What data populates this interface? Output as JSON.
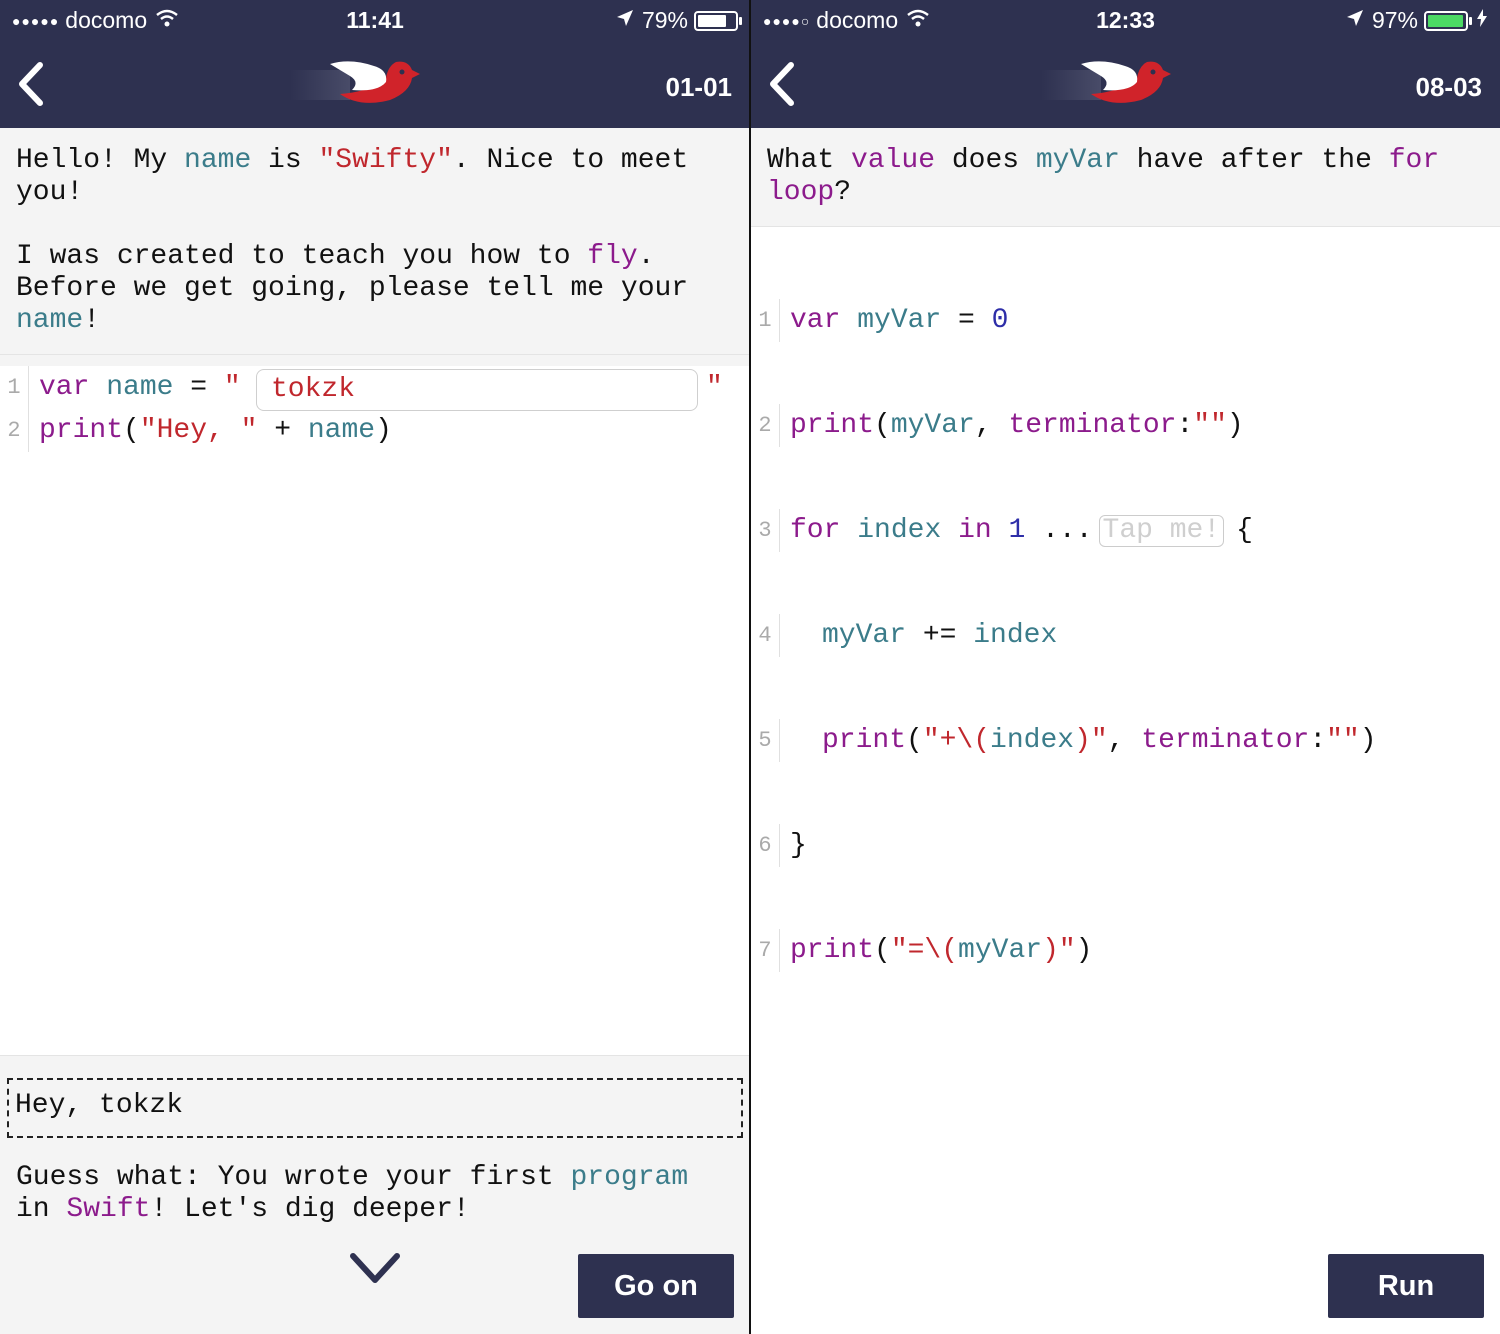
{
  "left": {
    "status": {
      "signal": "●●●●●",
      "carrier": "docomo",
      "time": "11:41",
      "battery": "79%",
      "battery_level": 0.79
    },
    "nav": {
      "back_icon": "chevron-left-icon",
      "logo": "swifty-bird-logo",
      "lesson": "01-01"
    },
    "prompt": {
      "l1": [
        "Hello! My ",
        "name",
        " is ",
        "\"Swifty\"",
        ". Nice to meet"
      ],
      "l2": "you!",
      "l3": [
        "I was created to teach you how to ",
        "fly",
        "."
      ],
      "l4": "Before we get going, please tell me your",
      "l5": [
        "name",
        "!"
      ]
    },
    "code": {
      "line_numbers": [
        "1",
        "2"
      ],
      "l1": {
        "var": "var",
        "name": "name",
        "eq": "=",
        "q1": "\"",
        "q2": "\""
      },
      "name_value": "tokzk",
      "l2": {
        "print": "print",
        "p1": "(",
        "str": "\"Hey, \"",
        "plus": " + ",
        "name": "name",
        "p2": ")"
      }
    },
    "output": "Hey, tokzk",
    "feedback": {
      "l1": [
        "Guess what: You wrote your first ",
        "program"
      ],
      "l2": [
        "in ",
        "Swift",
        "! Let's dig deeper!"
      ]
    },
    "expand_icon": "chevron-down-icon",
    "go_on": "Go on"
  },
  "right": {
    "status": {
      "signal": "●●●●○",
      "carrier": "docomo",
      "time": "12:33",
      "battery": "97%",
      "battery_level": 0.97
    },
    "nav": {
      "back_icon": "chevron-left-icon",
      "logo": "swifty-bird-logo",
      "lesson": "08-03"
    },
    "prompt": {
      "l1": [
        "What ",
        "value",
        " does ",
        "myVar",
        " have after the ",
        "for"
      ],
      "l2": [
        "loop",
        "?"
      ]
    },
    "code": {
      "line_numbers": [
        "1",
        "2",
        "3",
        "4",
        "5",
        "6",
        "7"
      ],
      "l1": [
        "var",
        " ",
        "myVar",
        " = ",
        "0"
      ],
      "l2": [
        "print",
        "(",
        "myVar",
        ", ",
        "terminator",
        ":",
        "\"\"",
        ")"
      ],
      "l3": [
        "for",
        " ",
        "index",
        " ",
        "in",
        " ",
        "1",
        " ..."
      ],
      "tap_me": "Tap me!",
      "l3_end": "{",
      "l4": [
        "myVar",
        " += ",
        "index"
      ],
      "l5": [
        "print",
        "(",
        "\"+\\(",
        "index",
        ")\"",
        ", ",
        "terminator",
        ":",
        "\"\"",
        ")"
      ],
      "l6": "}",
      "l7": [
        "print",
        "(",
        "\"=\\(",
        "myVar",
        ")\"",
        ")"
      ]
    },
    "run": "Run"
  }
}
